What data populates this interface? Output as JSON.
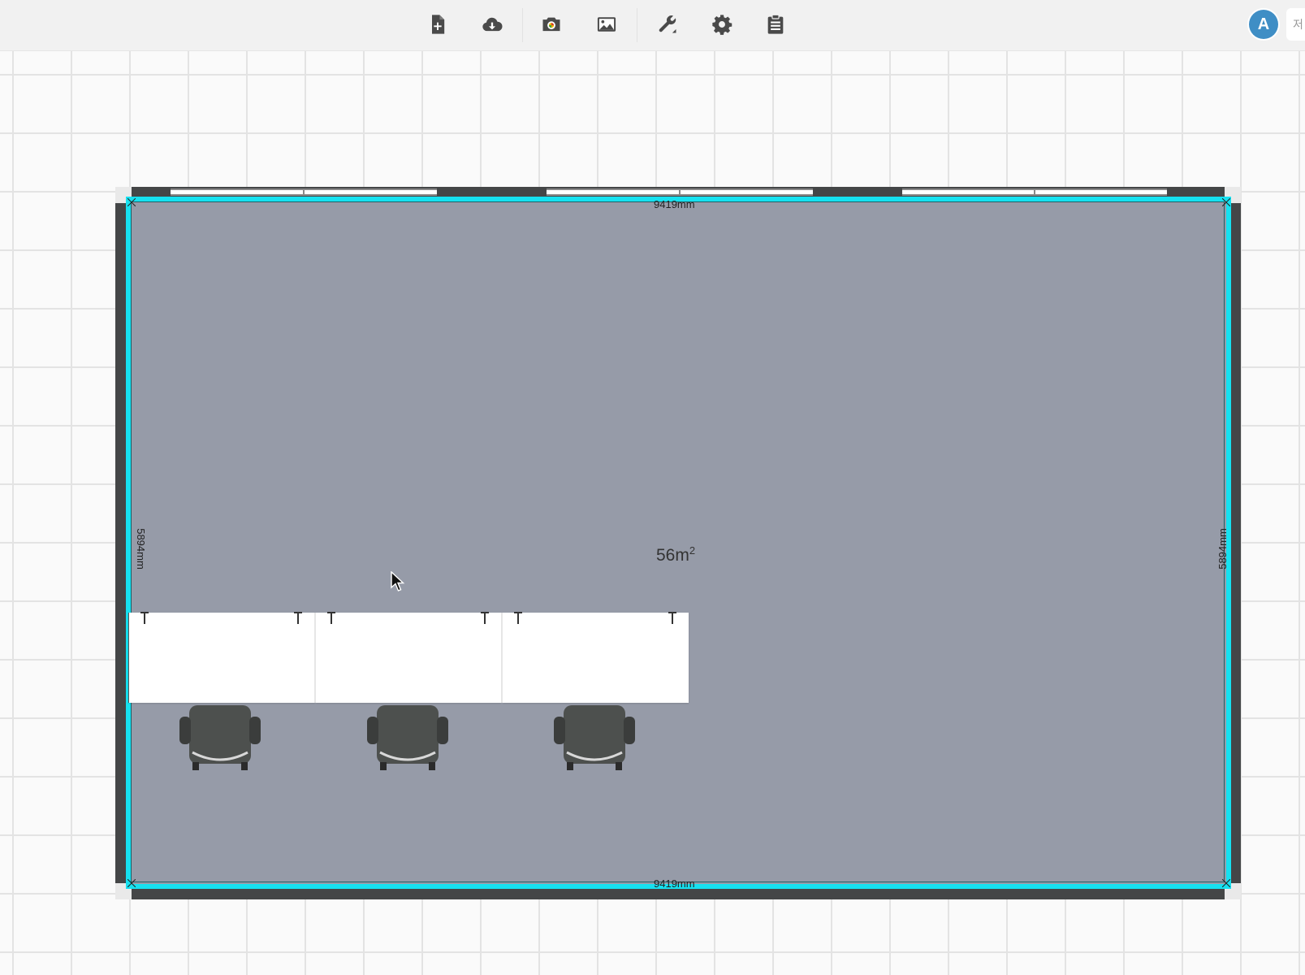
{
  "toolbar": {
    "items": [
      {
        "name": "new-document",
        "icon": "file-plus-icon"
      },
      {
        "name": "download-cloud",
        "icon": "cloud-download-icon"
      },
      {
        "name": "camera",
        "icon": "camera-icon"
      },
      {
        "name": "image",
        "icon": "image-icon"
      },
      {
        "name": "tools",
        "icon": "wrench-icon"
      },
      {
        "name": "settings",
        "icon": "gear-icon"
      },
      {
        "name": "clipboard",
        "icon": "clipboard-icon"
      }
    ],
    "icon_color": "#4a4a4a"
  },
  "user": {
    "avatar_letter": "A",
    "avatar_color": "#3f8ec5",
    "language_label": "저"
  },
  "room": {
    "area_value": "56m",
    "area_unit_sup": "2",
    "width_label_top": "9419mm",
    "width_label_bottom": "9419mm",
    "height_label_left": "5894mm",
    "height_label_right": "5894mm",
    "wall_color": "#444647",
    "floor_color": "#969ba8",
    "selection_color": "#16e1f0"
  },
  "furniture": {
    "desks": 3,
    "chairs": 3
  }
}
